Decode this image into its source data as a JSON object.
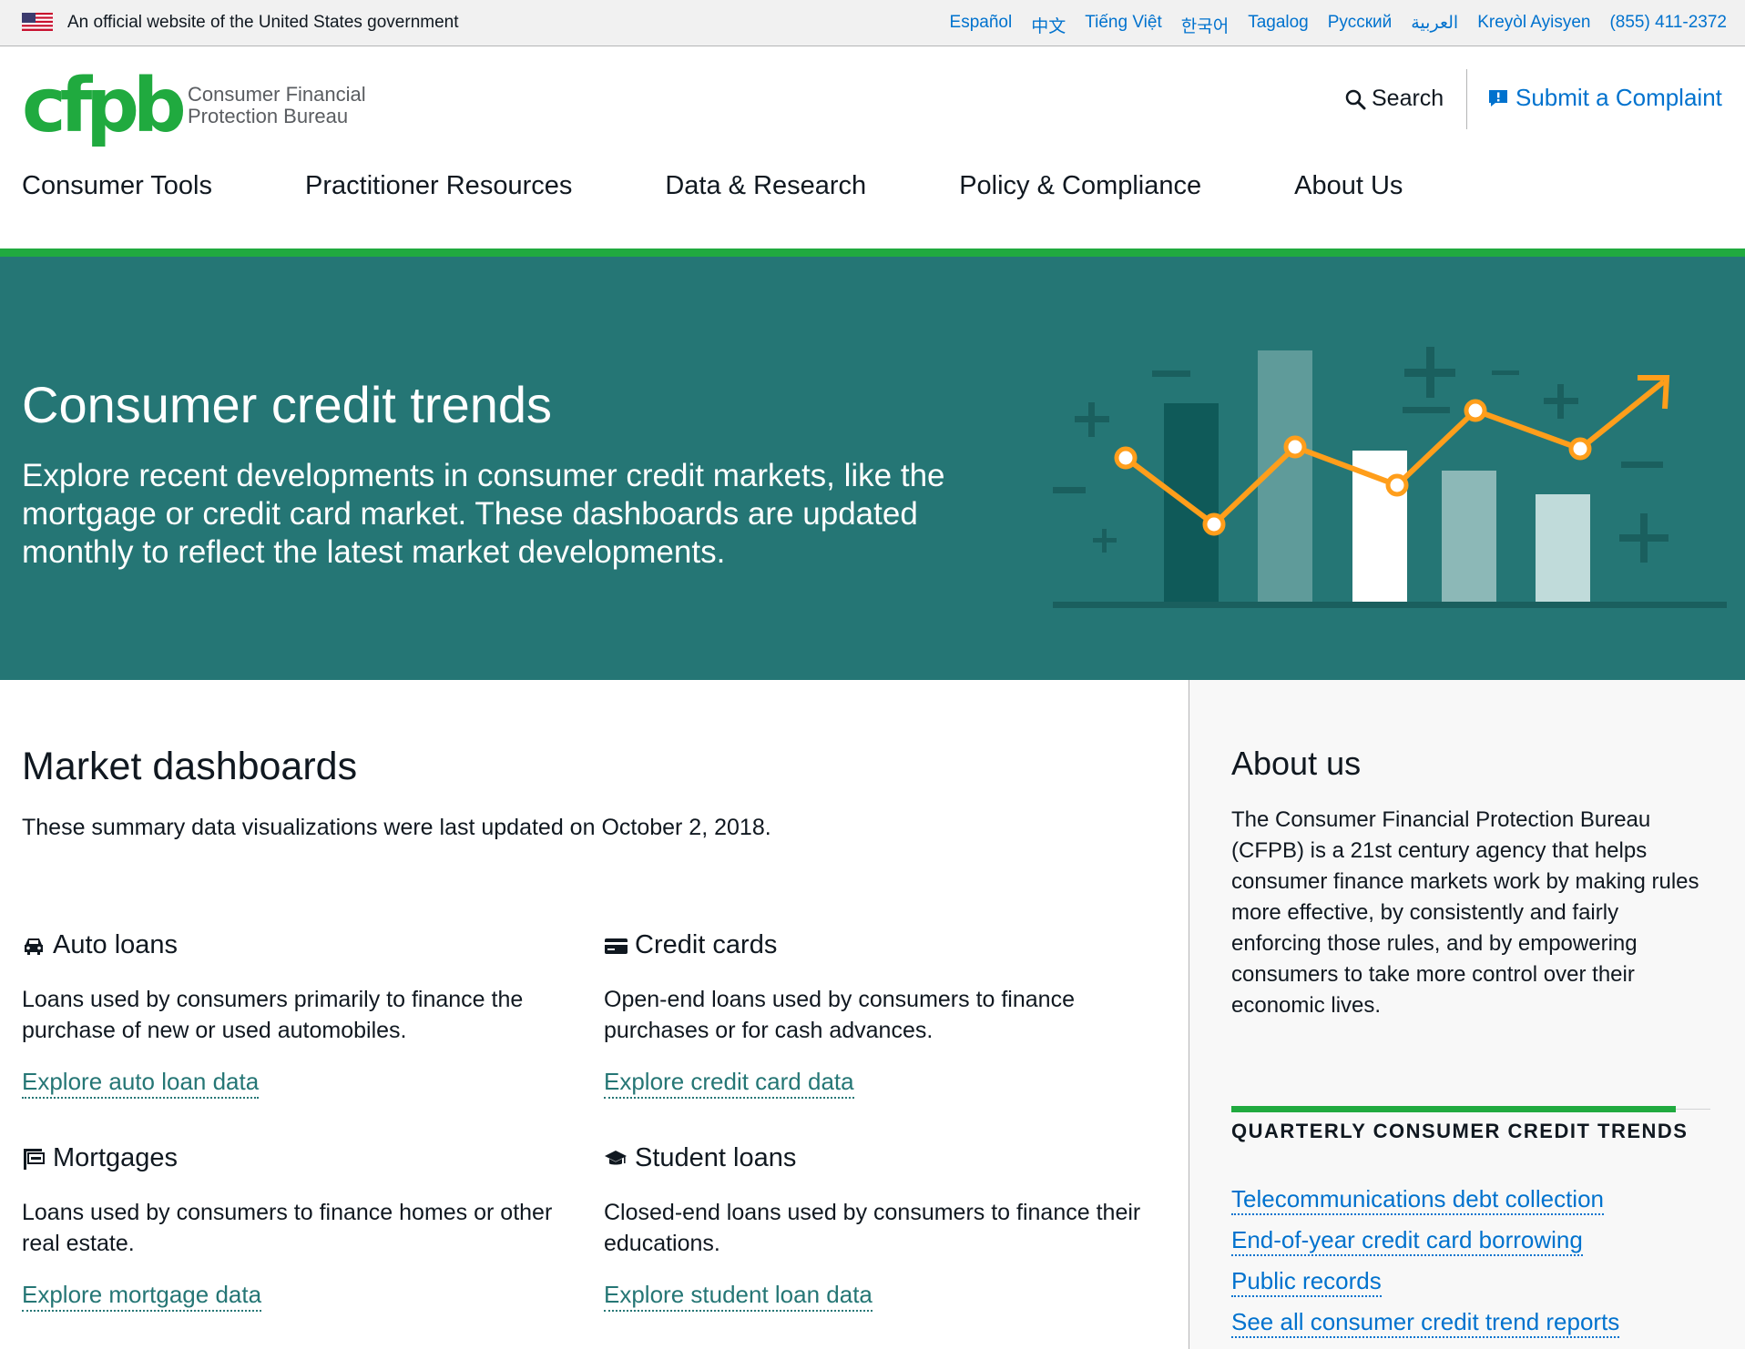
{
  "gov_banner": {
    "text": "An official website of the United States government",
    "languages": [
      "Español",
      "中文",
      "Tiếng Việt",
      "한국어",
      "Tagalog",
      "Русский",
      "العربية",
      "Kreyòl Ayisyen",
      "(855) 411-2372"
    ]
  },
  "header": {
    "logo_mark": "cfpb",
    "logo_line1": "Consumer Financial",
    "logo_line2": "Protection Bureau",
    "search_label": "Search",
    "complaint_label": "Submit a Complaint"
  },
  "nav": {
    "items": [
      "Consumer Tools",
      "Practitioner Resources",
      "Data & Research",
      "Policy & Compliance",
      "About Us"
    ]
  },
  "hero": {
    "title": "Consumer credit trends",
    "description": "Explore recent developments in consumer credit markets, like the mortgage or credit card market. These dashboards are updated monthly to reflect the latest market developments."
  },
  "dashboards": {
    "title": "Market dashboards",
    "updated": "These summary data visualizations were last updated on October 2, 2018.",
    "cards": [
      {
        "title": "Auto loans",
        "icon": "car-icon",
        "description": "Loans used by consumers primarily to finance the purchase of new or used automobiles.",
        "link": "Explore auto loan data"
      },
      {
        "title": "Credit cards",
        "icon": "credit-card-icon",
        "description": "Open-end loans used by consumers to finance purchases or for cash advances.",
        "link": "Explore credit card data"
      },
      {
        "title": "Mortgages",
        "icon": "sold-sign-icon",
        "description": "Loans used by consumers to finance homes or other real estate.",
        "link": "Explore mortgage data"
      },
      {
        "title": "Student loans",
        "icon": "graduation-cap-icon",
        "description": "Closed-end loans used by consumers to finance their educations.",
        "link": "Explore student loan data"
      }
    ]
  },
  "about": {
    "title": "About us",
    "text": "The Consumer Financial Protection Bureau (CFPB) is a 21st century agency that helps consumer finance markets work by making rules more effective, by consistently and fairly enforcing those rules, and by empowering consumers to take more control over their economic lives."
  },
  "quarterly": {
    "title": "QUARTERLY CONSUMER CREDIT TRENDS",
    "links": [
      "Telecommunications debt collection",
      "End-of-year credit card borrowing",
      "Public records",
      "See all consumer credit trend reports"
    ]
  },
  "colors": {
    "brand_green": "#20aa3f",
    "teal": "#257675",
    "link_blue": "#0072ce",
    "accent_orange": "#ff9e1b"
  }
}
